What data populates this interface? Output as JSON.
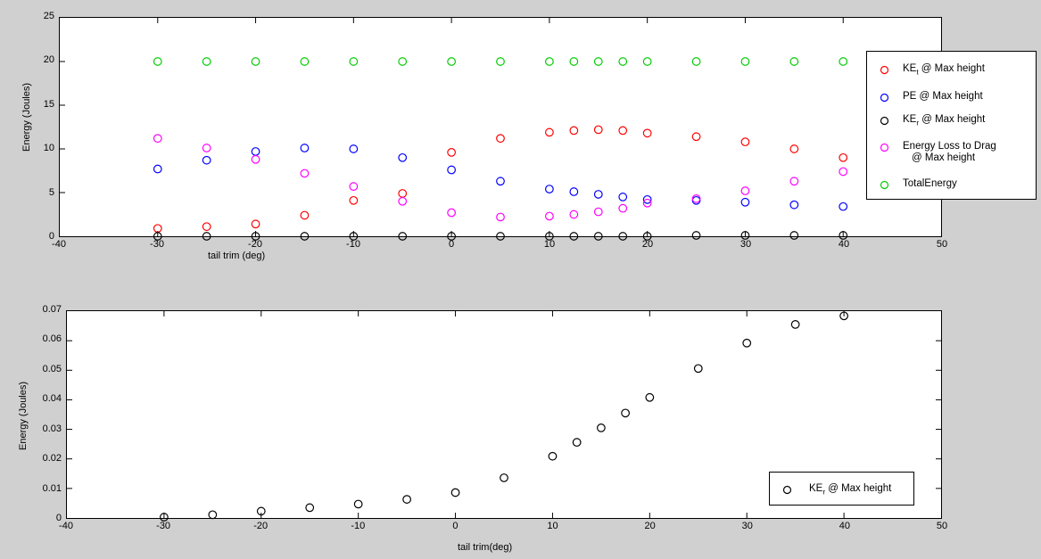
{
  "figure": {
    "background": "#d0d0d0",
    "plot_background": "#ffffff"
  },
  "colors": {
    "KEt": "#ff0000",
    "PE": "#0000ff",
    "KEr": "#000000",
    "drag": "#ff00ff",
    "total": "#00cc00"
  },
  "legend_top": {
    "items": [
      {
        "marker": "circle-marker-red",
        "color": "#ff0000",
        "main": "KE",
        "sub": "t",
        "rest": " @ Max height",
        "line2": ""
      },
      {
        "marker": "circle-marker-blue",
        "color": "#0000ff",
        "main": "PE",
        "sub": "",
        "rest": " @ Max height",
        "line2": ""
      },
      {
        "marker": "circle-marker-black",
        "color": "#000000",
        "main": "KE",
        "sub": "r",
        "rest": " @ Max height",
        "line2": ""
      },
      {
        "marker": "circle-marker-magenta",
        "color": "#ff00ff",
        "main": "Energy Loss to Drag",
        "sub": "",
        "rest": "",
        "line2": "@ Max height"
      },
      {
        "marker": "circle-marker-green",
        "color": "#00cc00",
        "main": "TotalEnergy",
        "sub": "",
        "rest": "",
        "line2": ""
      }
    ]
  },
  "legend_bottom": {
    "items": [
      {
        "marker": "circle-marker-black",
        "color": "#000000",
        "main": "KE",
        "sub": "r",
        "rest": " @ Max height",
        "line2": ""
      }
    ]
  },
  "chart_data": [
    {
      "id": "top",
      "type": "scatter",
      "title": "",
      "xlabel": "tail trim (deg)",
      "ylabel": "Energy (Joules)",
      "xlim": [
        -40,
        50
      ],
      "ylim": [
        0,
        25
      ],
      "xticks": [
        -40,
        -30,
        -20,
        -10,
        0,
        10,
        20,
        30,
        40,
        50
      ],
      "xticklabels": [
        "-40",
        "-30",
        "-20",
        "-10",
        "0",
        "10",
        "20",
        "30",
        "40",
        "50"
      ],
      "yticks": [
        0,
        5,
        10,
        15,
        20,
        25
      ],
      "yticklabels": [
        "0",
        "5",
        "10",
        "15",
        "20",
        "25"
      ],
      "grid": false,
      "legend_position": "upper-right-outside",
      "x": [
        -30,
        -25,
        -20,
        -15,
        -10,
        -5,
        0,
        5,
        10,
        12.5,
        15,
        17.5,
        20,
        25,
        30,
        35,
        40
      ],
      "series": [
        {
          "name": "KE_t @ Max height",
          "color": "#ff0000",
          "values": [
            0.9,
            1.1,
            1.4,
            2.4,
            4.1,
            4.9,
            9.6,
            11.2,
            11.9,
            12.1,
            12.2,
            12.1,
            11.8,
            11.4,
            10.8,
            10.0,
            9.0
          ]
        },
        {
          "name": "PE @ Max height",
          "color": "#0000ff",
          "values": [
            7.7,
            8.7,
            9.7,
            10.1,
            10.0,
            9.0,
            7.6,
            6.3,
            5.4,
            5.1,
            4.8,
            4.5,
            4.2,
            4.1,
            3.9,
            3.6,
            3.4
          ]
        },
        {
          "name": "KE_r @ Max height",
          "color": "#000000",
          "values": [
            0.0,
            0.0,
            0.0,
            0.0,
            0.0,
            0.0,
            0.0,
            0.0,
            0.0,
            0.0,
            0.0,
            0.0,
            0.0,
            0.1,
            0.1,
            0.1,
            0.1
          ]
        },
        {
          "name": "Energy Loss to Drag @ Max height",
          "color": "#ff00ff",
          "values": [
            11.2,
            10.1,
            8.8,
            7.2,
            5.7,
            4.0,
            2.7,
            2.2,
            2.3,
            2.5,
            2.8,
            3.2,
            3.8,
            4.3,
            5.2,
            6.3,
            7.4
          ]
        },
        {
          "name": "TotalEnergy",
          "color": "#00cc00",
          "values": [
            20,
            20,
            20,
            20,
            20,
            20,
            20,
            20,
            20,
            20,
            20,
            20,
            20,
            20,
            20,
            20,
            20
          ]
        }
      ]
    },
    {
      "id": "bottom",
      "type": "scatter",
      "title": "",
      "xlabel": "tail trim(deg)",
      "ylabel": "Energy (Joules)",
      "xlim": [
        -40,
        50
      ],
      "ylim": [
        0,
        0.07
      ],
      "xticks": [
        -40,
        -30,
        -20,
        -10,
        0,
        10,
        20,
        30,
        40,
        50
      ],
      "xticklabels": [
        "-40",
        "-30",
        "-20",
        "-10",
        "0",
        "10",
        "20",
        "30",
        "40",
        "50"
      ],
      "yticks": [
        0,
        0.01,
        0.02,
        0.03,
        0.04,
        0.05,
        0.06,
        0.07
      ],
      "yticklabels": [
        "0",
        "0.01",
        "0.02",
        "0.03",
        "0.04",
        "0.05",
        "0.06",
        "0.07"
      ],
      "grid": false,
      "legend_position": "lower-right-inside",
      "x": [
        -30,
        -25,
        -20,
        -15,
        -10,
        -5,
        0,
        5,
        10,
        12.5,
        15,
        17.5,
        20,
        25,
        30,
        35,
        40
      ],
      "series": [
        {
          "name": "KE_r @ Max height",
          "color": "#000000",
          "values": [
            0.0003,
            0.0011,
            0.0023,
            0.0035,
            0.0047,
            0.0063,
            0.0086,
            0.0136,
            0.0209,
            0.0256,
            0.0305,
            0.0355,
            0.0408,
            0.0506,
            0.0592,
            0.0655,
            0.0684
          ]
        }
      ]
    }
  ]
}
